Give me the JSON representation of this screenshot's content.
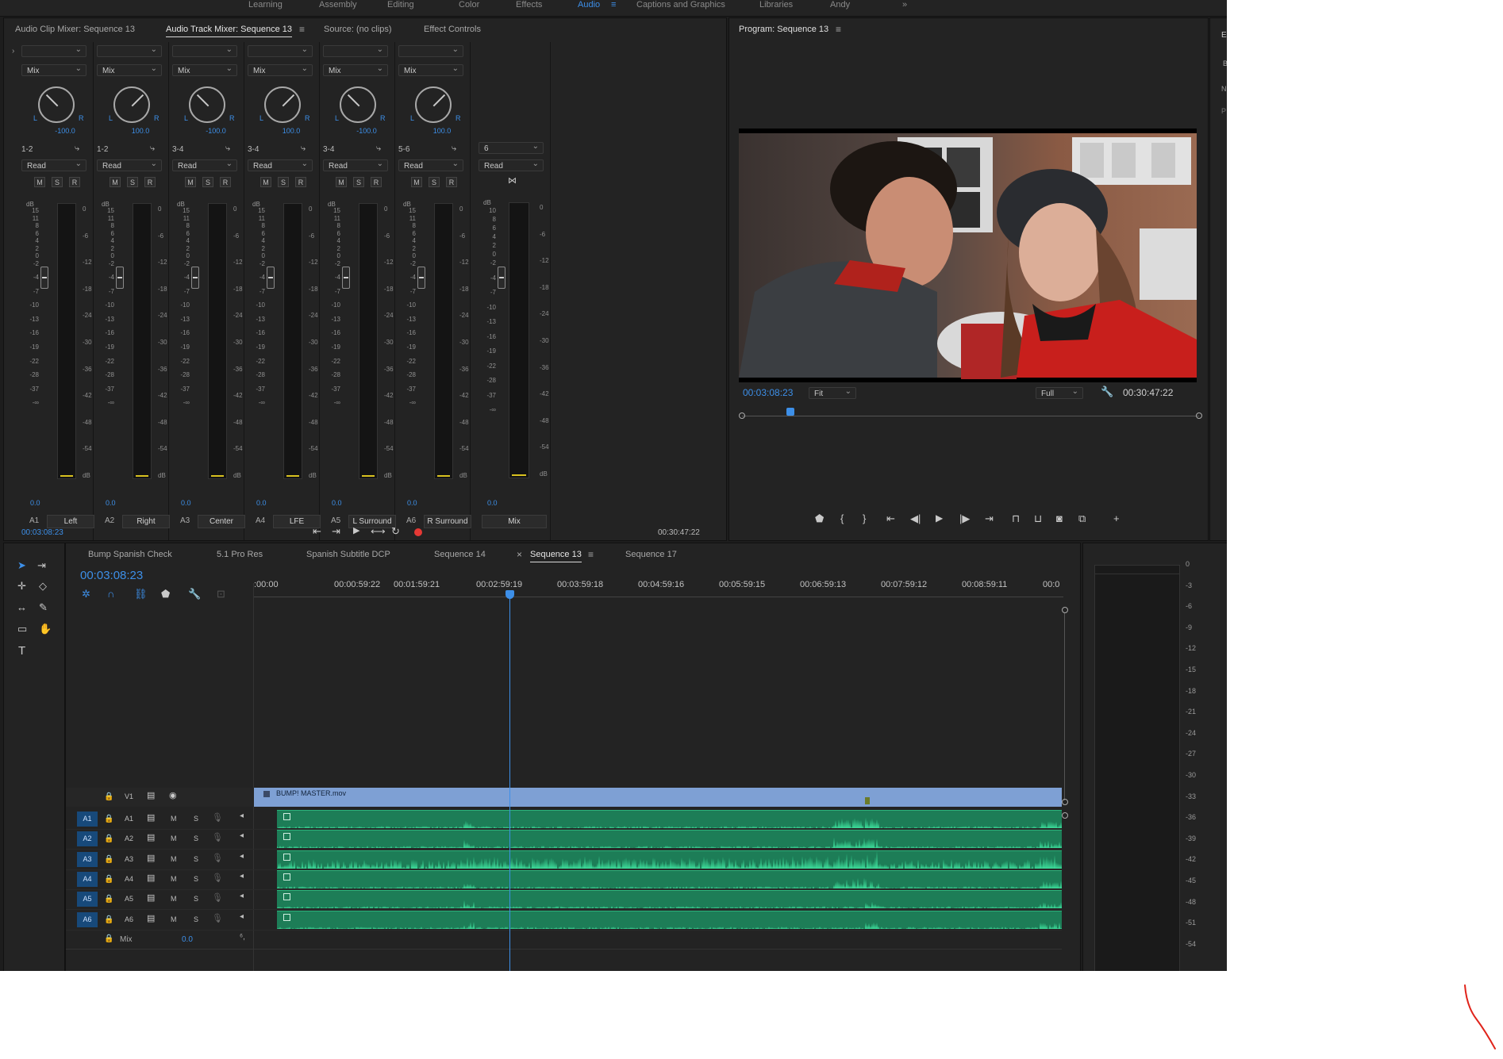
{
  "workspaces": [
    "Learning",
    "Assembly",
    "Editing",
    "Color",
    "Effects",
    "Audio",
    "Captions and Graphics",
    "Libraries",
    "Andy"
  ],
  "source_panel": {
    "tabs": [
      "Audio Clip Mixer: Sequence 13",
      "Audio Track Mixer: Sequence 13",
      "Source: (no clips)",
      "Effect Controls"
    ],
    "active_tab": "Audio Track Mixer: Sequence 13",
    "timecode_left": "00:03:08:23",
    "timecode_right": "00:30:47:22"
  },
  "mixer": {
    "channels": [
      {
        "mode": "Mix",
        "pan": "-100.0",
        "routing": "1-2",
        "automation": "Read",
        "gain": "0.0",
        "track": "A1",
        "name": "Left",
        "pan_angle": -45
      },
      {
        "mode": "Mix",
        "pan": "100.0",
        "routing": "1-2",
        "automation": "Read",
        "gain": "0.0",
        "track": "A2",
        "name": "Right",
        "pan_angle": 45
      },
      {
        "mode": "Mix",
        "pan": "-100.0",
        "routing": "3-4",
        "automation": "Read",
        "gain": "0.0",
        "track": "A3",
        "name": "Center",
        "pan_angle": -45
      },
      {
        "mode": "Mix",
        "pan": "100.0",
        "routing": "3-4",
        "automation": "Read",
        "gain": "0.0",
        "track": "A4",
        "name": "LFE",
        "pan_angle": 45
      },
      {
        "mode": "Mix",
        "pan": "-100.0",
        "routing": "3-4",
        "automation": "Read",
        "gain": "0.0",
        "track": "A5",
        "name": "L Surround",
        "pan_angle": -45
      },
      {
        "mode": "Mix",
        "pan": "100.0",
        "routing": "5-6",
        "automation": "Read",
        "gain": "0.0",
        "track": "A6",
        "name": "R Surround",
        "pan_angle": 45
      }
    ],
    "master": {
      "routing": "6",
      "automation": "Read",
      "gain": "0.0",
      "name": "Mix"
    },
    "msr": [
      "M",
      "S",
      "R"
    ],
    "lr": [
      "L",
      "R"
    ],
    "db_label": "dB",
    "left_scale": [
      "15",
      "11",
      "8",
      "6",
      "4",
      "2",
      "0",
      "-2",
      "-4",
      "-7",
      "-10",
      "-13",
      "-16",
      "-19",
      "-22",
      "-28",
      "-37",
      "-∞"
    ],
    "right_scale": [
      "0",
      "-6",
      "-12",
      "-18",
      "-24",
      "-30",
      "-36",
      "-42",
      "-48",
      "-54",
      "dB"
    ],
    "master_left_scale": [
      "10",
      "8",
      "6",
      "4",
      "2",
      "0",
      "-2",
      "-4",
      "-7",
      "-10",
      "-13",
      "-16",
      "-19",
      "-22",
      "-28",
      "-37",
      "-∞"
    ]
  },
  "program": {
    "title": "Program: Sequence 13",
    "timecode": "00:03:08:23",
    "fit": "Fit",
    "quality": "Full",
    "duration": "00:30:47:22",
    "playhead_fraction": 0.102
  },
  "timeline": {
    "tabs": [
      "Bump Spanish Check",
      "5.1 Pro Res",
      "Spanish Subtitle DCP",
      "Sequence 14",
      "Sequence 13",
      "Sequence 17"
    ],
    "active_tab": "Sequence 13",
    "close_glyph": "×",
    "timecode": "00:03:08:23",
    "ruler": [
      ":00:00",
      "00:00:59:22",
      "00:01:59:21",
      "00:02:59:19",
      "00:03:59:18",
      "00:04:59:16",
      "00:05:59:15",
      "00:06:59:13",
      "00:07:59:12",
      "00:08:59:11",
      "00:0"
    ],
    "video_track": {
      "label": "V1",
      "clip": "BUMP! MASTER.mov"
    },
    "audio_tracks": [
      {
        "src": "A1",
        "label": "A1",
        "m": "M",
        "s": "S"
      },
      {
        "src": "A2",
        "label": "A2",
        "m": "M",
        "s": "S"
      },
      {
        "src": "A3",
        "label": "A3",
        "m": "M",
        "s": "S"
      },
      {
        "src": "A4",
        "label": "A4",
        "m": "M",
        "s": "S"
      },
      {
        "src": "A5",
        "label": "A5",
        "m": "M",
        "s": "S"
      },
      {
        "src": "A6",
        "label": "A6",
        "m": "M",
        "s": "S"
      }
    ],
    "mix": {
      "label": "Mix",
      "value": "0.0"
    }
  },
  "right_meter": {
    "scale": [
      "0",
      "-3",
      "-6",
      "-9",
      "-12",
      "-15",
      "-18",
      "-21",
      "-24",
      "-27",
      "-30",
      "-33",
      "-36",
      "-39",
      "-42",
      "-45",
      "-48",
      "-51",
      "-54"
    ]
  },
  "effects_panel_letters": [
    "E",
    "B",
    "N",
    "P"
  ],
  "colors": {
    "accent": "#3d8fe8",
    "audio_clip": "#1d7d57",
    "waveform": "#3ddc9a",
    "video_clip": "#7ea0d4",
    "record": "#e53935",
    "annotation": "#e0241b"
  },
  "icons": [
    "panel-menu-icon",
    "wrench-icon",
    "play-icon",
    "step-back-icon",
    "step-forward-icon",
    "go-to-in-icon",
    "go-to-out-icon",
    "record-icon",
    "marker-icon",
    "camera-icon",
    "plus-icon",
    "selection-tool-icon",
    "track-select-icon",
    "ripple-edit-icon",
    "razor-icon",
    "slip-icon",
    "pen-icon",
    "rectangle-icon",
    "hand-icon",
    "type-icon",
    "lock-icon",
    "eye-icon",
    "mic-icon",
    "film-icon",
    "snap-icon",
    "link-icon"
  ]
}
